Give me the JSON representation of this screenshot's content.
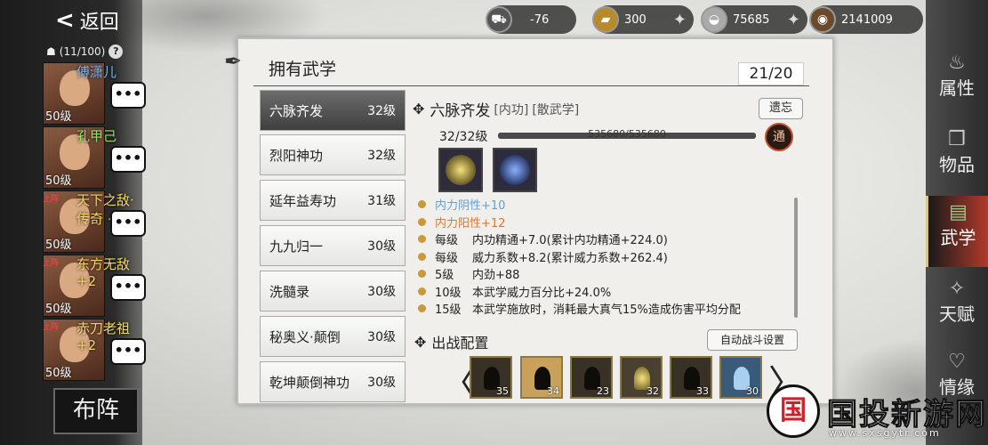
{
  "nav": {
    "back_label": "返回",
    "team_count": "(11/100)",
    "help": "?"
  },
  "resources": [
    {
      "icon": "cart-icon",
      "value": "-76"
    },
    {
      "icon": "gold-bar-icon",
      "value": "300"
    },
    {
      "icon": "silver-ingot-icon",
      "value": "75685"
    },
    {
      "icon": "coin-icon",
      "value": "2141009"
    }
  ],
  "heroes": [
    {
      "name": "傅潇儿",
      "level": "50级",
      "name_color": "#6fb6ff",
      "tag": ""
    },
    {
      "name": "孔甲己",
      "level": "50级",
      "name_color": "#8ee06e",
      "tag": ""
    },
    {
      "name": "天下之敌·传奇 +4",
      "level": "50级",
      "name_color": "#f4d66a",
      "tag": "上阵"
    },
    {
      "name": "东方无敌 +2",
      "level": "50级",
      "name_color": "#f4d66a",
      "tag": "上阵"
    },
    {
      "name": "赤刀老祖 +2",
      "level": "50级",
      "name_color": "#f4d66a",
      "tag": "上阵"
    }
  ],
  "formation_label": "布阵",
  "right_nav": [
    {
      "label": "属性",
      "icon": "gourd-icon",
      "active": false
    },
    {
      "label": "物品",
      "icon": "box-icon",
      "active": false
    },
    {
      "label": "武学",
      "icon": "book-icon",
      "active": true
    },
    {
      "label": "天赋",
      "icon": "sparkle-icon",
      "active": false
    },
    {
      "label": "情缘",
      "icon": "heart-icon",
      "active": false
    }
  ],
  "panel": {
    "title": "拥有武学",
    "count": "21/20"
  },
  "skills": [
    {
      "name": "六脉齐发",
      "level": "32级",
      "selected": true
    },
    {
      "name": "烈阳神功",
      "level": "32级"
    },
    {
      "name": "延年益寿功",
      "level": "31级"
    },
    {
      "name": "九九归一",
      "level": "30级"
    },
    {
      "name": "洗髓录",
      "level": "30级"
    },
    {
      "name": "秘奥义·颠倒",
      "level": "30级"
    },
    {
      "name": "乾坤颠倒神功",
      "level": "30级"
    }
  ],
  "detail": {
    "name": "六脉齐发",
    "tag1": "[内功]",
    "tag2": "[散武学]",
    "forget_label": "遗忘",
    "level_text": "32/32级",
    "exp_text": "535680/535680",
    "exp_ratio": 1.0,
    "tong_label": "通",
    "stats": [
      {
        "k": "",
        "v": "内力阴性+10",
        "cls": "blue"
      },
      {
        "k": "",
        "v": "内力阳性+12",
        "cls": "orange"
      },
      {
        "k": "每级",
        "v": "内功精通+7.0(累计内功精通+224.0)",
        "cls": ""
      },
      {
        "k": "每级",
        "v": "威力系数+8.2(累计威力系数+262.4)",
        "cls": ""
      },
      {
        "k": "5级",
        "v": "内劲+88",
        "cls": ""
      },
      {
        "k": "10级",
        "v": "本武学威力百分比+24.0%",
        "cls": ""
      },
      {
        "k": "15级",
        "v": "本武学施放时，消耗最大真气15%造成伤害平均分配",
        "cls": ""
      }
    ]
  },
  "battle": {
    "title": "出战配置",
    "auto_label": "自动战斗设置",
    "slots": [
      "35",
      "34",
      "23",
      "32",
      "33",
      "30"
    ]
  },
  "watermark": {
    "logo": "国",
    "title": "国投新游网",
    "url": "www.sxsgytr.com"
  }
}
